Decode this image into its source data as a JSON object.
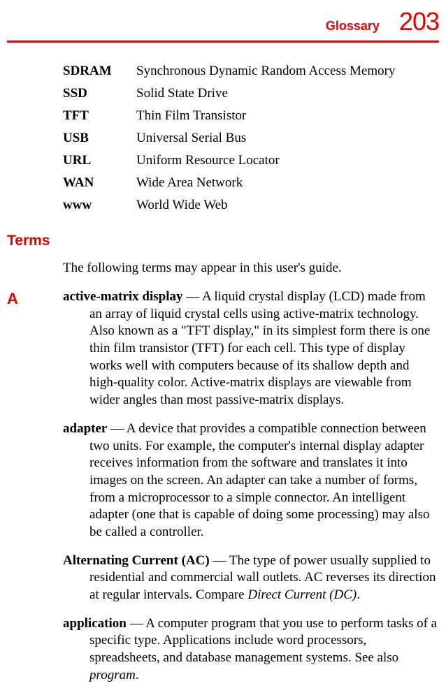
{
  "header": {
    "section": "Glossary",
    "page": "203"
  },
  "acronyms": [
    {
      "term": "SDRAM",
      "def": "Synchronous Dynamic Random Access Memory"
    },
    {
      "term": "SSD",
      "def": "Solid State Drive"
    },
    {
      "term": "TFT",
      "def": "Thin Film Transistor"
    },
    {
      "term": "USB",
      "def": "Universal Serial Bus"
    },
    {
      "term": "URL",
      "def": "Uniform Resource Locator"
    },
    {
      "term": "WAN",
      "def": "Wide Area Network"
    },
    {
      "term": "www",
      "def": "World Wide Web"
    }
  ],
  "terms_heading": "Terms",
  "terms_intro": "The following terms may appear in this user's guide.",
  "letter": "A",
  "definitions": [
    {
      "term": "active-matrix display",
      "sep": " — ",
      "body": "A liquid crystal display (LCD) made from an array of liquid crystal cells using active-matrix technology. Also known as a \"TFT display,\" in its simplest form there is one thin film transistor (TFT) for each cell. This type of display works well with computers because of its shallow depth and high-quality color. Active-matrix displays are viewable from wider angles than most passive-matrix displays.",
      "tail_italic": "",
      "tail_after": ""
    },
    {
      "term": "adapter",
      "sep": " — ",
      "body": "A device that provides a compatible connection between two units. For example, the computer's internal display adapter receives information from the software and translates it into images on the screen. An adapter can take a number of forms, from a microprocessor to a simple connector. An intelligent adapter (one that is capable of doing some processing) may also be called a controller.",
      "tail_italic": "",
      "tail_after": ""
    },
    {
      "term": "Alternating Current (AC)",
      "sep": " — ",
      "body": "The type of power usually supplied to residential and commercial wall outlets. AC reverses its direction at regular intervals. Compare ",
      "tail_italic": "Direct Current (DC)",
      "tail_after": "."
    },
    {
      "term": "application",
      "sep": " — ",
      "body": "A computer program that you use to perform tasks of a specific type. Applications include word processors, spreadsheets, and database management systems. See also ",
      "tail_italic": "program",
      "tail_after": "."
    }
  ]
}
